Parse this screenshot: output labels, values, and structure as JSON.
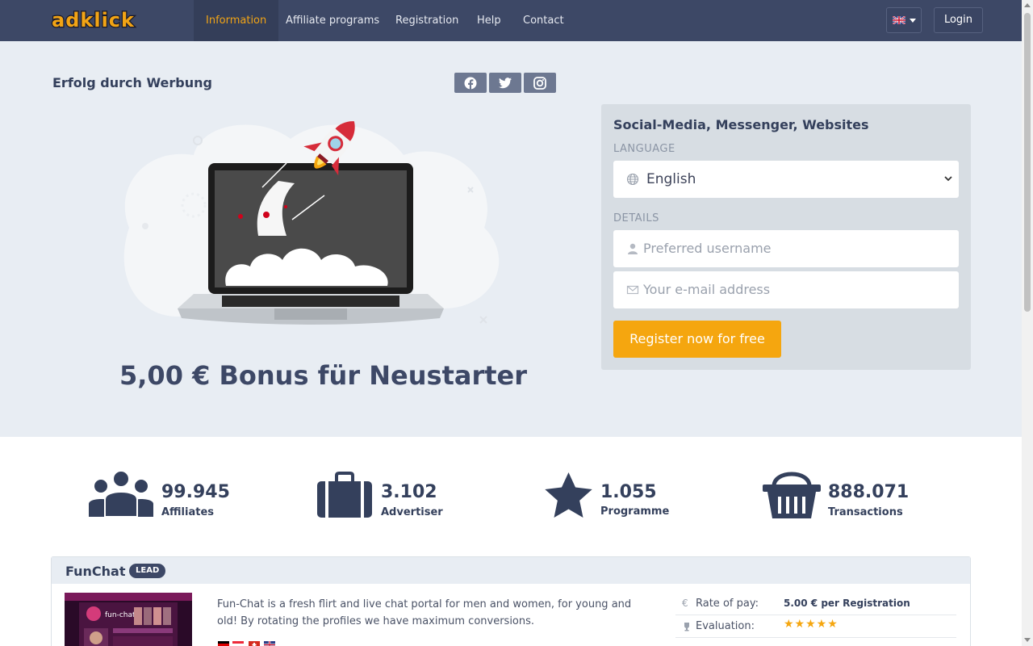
{
  "nav": {
    "logo_text": "adklick",
    "items": [
      {
        "label": "Information",
        "active": true
      },
      {
        "label": "Affiliate programs",
        "active": false
      },
      {
        "label": "Registration",
        "active": false
      },
      {
        "label": "Help",
        "active": false
      },
      {
        "label": "Contact",
        "active": false
      }
    ],
    "language_flag": "uk-flag-icon",
    "login_label": "Login"
  },
  "hero": {
    "slogan": "Erfolg durch Werbung",
    "social": [
      "facebook-icon",
      "twitter-icon",
      "instagram-icon"
    ],
    "bonus": "5,00 € Bonus für Neustarter"
  },
  "register": {
    "title": "Social-Media, Messenger, Websites",
    "language_label": "LANGUAGE",
    "language_value": "English",
    "details_label": "DETAILS",
    "username_placeholder": "Preferred username",
    "email_placeholder": "Your e-mail address",
    "submit_label": "Register now for free"
  },
  "stats": [
    {
      "value": "99.945",
      "label": "Affiliates",
      "icon": "users-icon"
    },
    {
      "value": "3.102",
      "label": "Advertiser",
      "icon": "briefcase-icon"
    },
    {
      "value": "1.055",
      "label": "Programme",
      "icon": "star-icon"
    },
    {
      "value": "888.071",
      "label": "Transactions",
      "icon": "basket-icon"
    }
  ],
  "program": {
    "title": "FunChat",
    "badge": "LEAD",
    "description": "Fun-Chat is a fresh flirt and live chat portal for men and women, for young and old! By rotating the profiles we have maximum conversions.",
    "rate_icon": "€",
    "rate_label": "Rate of pay:",
    "rate_value": "5.00 € per Registration",
    "eval_label": "Evaluation:",
    "eval_stars": "★★★★★",
    "rating": 5,
    "thumb_text": "fun-chat"
  },
  "colors": {
    "navbar": "#3d4866",
    "accent": "#f2a415",
    "button": "#f5a60f",
    "hero_bg": "#e8edf3",
    "text_dark": "#34405c"
  }
}
